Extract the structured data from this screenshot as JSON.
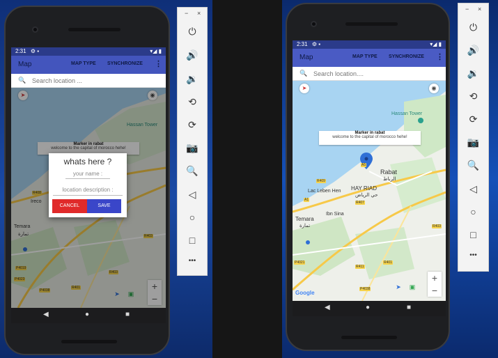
{
  "left_phone": {
    "status_time": "2:31",
    "status_icons_left": "⚙ ▪",
    "status_icons_right": "▾◢ ▮",
    "app_title": "Map",
    "action_map_type": "MAP TYPE",
    "action_synchronize": "SYNCHRONIZE",
    "search_placeholder": "Search location ...",
    "map_labels": {
      "hassan_tower": "Hassan Tower",
      "temara": "Temara",
      "temara_ar": "تمارة",
      "la_ireco": "Ireco"
    },
    "info_window": {
      "title": "Marker in rabat",
      "subtitle": "welcome to the capital of morocco hehe!"
    },
    "dialog": {
      "title": "whats here ?",
      "name_hint": "your name :",
      "description_hint": "location description :",
      "cancel_label": "CANCEL",
      "save_label": "SAVE",
      "cancel_color": "#e02a2a",
      "save_color": "#3a46c9"
    },
    "zoom_in": "+",
    "zoom_out": "−",
    "road_badges": [
      "R408",
      "R403",
      "N1",
      "R407",
      "P4019",
      "A5",
      "R403",
      "P4023",
      "P4021",
      "R401",
      "P4038"
    ]
  },
  "right_phone": {
    "status_time": "2:31",
    "status_icons_left": "⚙ ▪",
    "status_icons_right": "▾◢ ▮",
    "app_title": "Map",
    "action_map_type": "MAP TYPE",
    "action_synchronize": "SYNCHRONIZE",
    "search_placeholder": "Search location....",
    "map_labels": {
      "hassan_tower": "Hassan Tower",
      "rabat": "Rabat",
      "rabat_ar": "الرباط",
      "hay_riad": "HAY RIAD",
      "hay_riad_ar": "حي الرياض",
      "ibn_sina": "Ibn Sina",
      "lac_leben": "Lac Leben Hen",
      "temara": "Temara",
      "temara_ar": "تمارة",
      "google": "Google"
    },
    "info_window": {
      "title": "Marker in rabat",
      "subtitle": "welcome to the capital of morocco hehe!"
    },
    "zoom_in": "+",
    "zoom_out": "−",
    "road_badges": [
      "A5",
      "R409",
      "R407",
      "P4023",
      "A1",
      "P4019",
      "R403",
      "P4021",
      "R401",
      "R411",
      "P4038",
      "R401",
      "P4020"
    ]
  },
  "nav": {
    "back": "◀",
    "home": "●",
    "recents": "■"
  },
  "emulator_left": {
    "minimize": "−",
    "close": "×",
    "tools": [
      "power-icon",
      "volume-up-icon",
      "volume-down-icon",
      "rotate-left-icon",
      "rotate-right-icon",
      "camera-icon",
      "zoom-icon",
      "back-icon",
      "home-icon",
      "overview-icon",
      "more-icon"
    ],
    "glyphs": [
      "⏻",
      "🔊",
      "🔉",
      "⟲",
      "⟳",
      "📷",
      "🔍",
      "◁",
      "○",
      "□",
      "•••"
    ]
  },
  "emulator_right": {
    "minimize": "−",
    "close": "×",
    "tools": [
      "power-icon",
      "volume-up-icon",
      "volume-down-icon",
      "rotate-left-icon",
      "rotate-right-icon",
      "camera-icon",
      "zoom-icon",
      "back-icon",
      "home-icon",
      "overview-icon",
      "more-icon"
    ],
    "glyphs": [
      "⏻",
      "🔊",
      "🔉",
      "⟲",
      "⟳",
      "📷",
      "🔍",
      "◁",
      "○",
      "□",
      "•••"
    ]
  },
  "colors": {
    "status_bar": "#2b3b8a",
    "app_bar": "#4355bd",
    "marker": "#2f6fd6",
    "highway": "#f7c948"
  }
}
